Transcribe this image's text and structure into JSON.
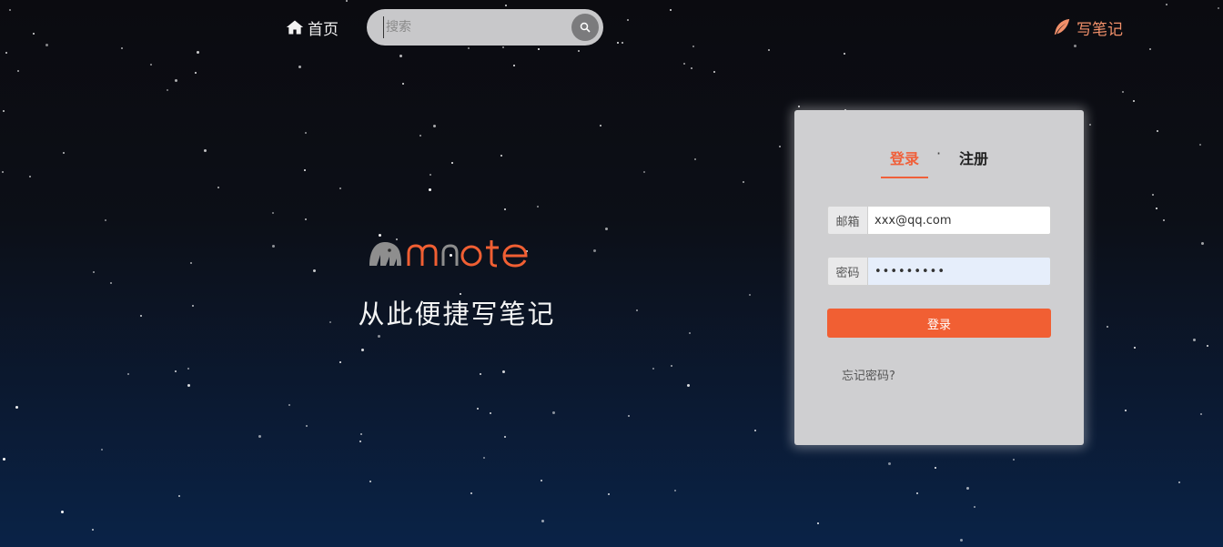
{
  "nav": {
    "home_label": "首页",
    "home_icon": "home-icon",
    "write_label": "写笔记",
    "write_icon": "feather-icon",
    "write_color": "#f1906a"
  },
  "search": {
    "placeholder": "搜索",
    "value": "",
    "button_icon": "search-icon"
  },
  "brand": {
    "logo_text": "note",
    "slogan": "从此便捷写笔记",
    "accent_color": "#f15f33"
  },
  "login": {
    "tabs": [
      {
        "label": "登录",
        "active": true
      },
      {
        "label": "注册",
        "active": false
      }
    ],
    "separator": "·",
    "email_label": "邮箱",
    "email_value": "xxx@qq.com",
    "password_label": "密码",
    "password_value": "•••••••••",
    "submit_label": "登录",
    "forgot_label": "忘记密码?"
  }
}
